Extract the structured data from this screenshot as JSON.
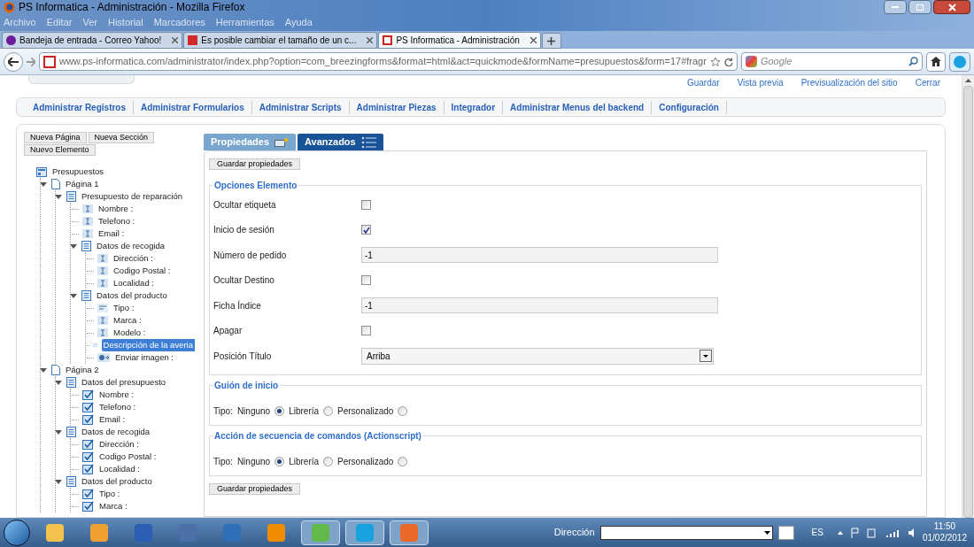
{
  "window": {
    "title": "PS Informatica - Administración - Mozilla Firefox"
  },
  "menu": [
    "Archivo",
    "Editar",
    "Ver",
    "Historial",
    "Marcadores",
    "Herramientas",
    "Ayuda"
  ],
  "browser_tabs": [
    {
      "label": "Bandeja de entrada - Correo Yahoo!",
      "selected": false
    },
    {
      "label": "Es posible cambiar el tamaño de un c...",
      "selected": false
    },
    {
      "label": "PS Informatica - Administración",
      "selected": true
    }
  ],
  "address": "www.ps-informatica.com/administrator/index.php?option=com_breezingforms&format=html&act=quickmode&formName=presupuestos&form=17#fragr",
  "search": {
    "placeholder": "Google"
  },
  "top_links": [
    "Guardar",
    "Vista previa",
    "Previsualización del sitio",
    "Cerrar"
  ],
  "nav": [
    "Administrar Registros",
    "Administrar Formularios",
    "Administrar Scripts",
    "Administrar Piezas",
    "Integrador",
    "Administrar Menus del backend",
    "Configuración"
  ],
  "tree_buttons": [
    "Nueva Página",
    "Nueva Sección",
    "Nuevo Elemento"
  ],
  "tree": {
    "label": "Presupuestos",
    "kind": "form",
    "children": [
      {
        "label": "Página 1",
        "kind": "page",
        "expanded": true,
        "children": [
          {
            "label": "Presupuesto de reparación",
            "kind": "section",
            "expanded": true,
            "children": [
              {
                "label": "Nombre :",
                "kind": "text",
                "selected": false
              },
              {
                "label": "Telefono :",
                "kind": "text",
                "selected": false
              },
              {
                "label": "Email :",
                "kind": "text",
                "selected": false
              },
              {
                "label": "Datos de recogida",
                "kind": "section",
                "expanded": true,
                "children": [
                  {
                    "label": "Dirección :",
                    "kind": "text",
                    "selected": false
                  },
                  {
                    "label": "Codigo Postal :",
                    "kind": "text",
                    "selected": false
                  },
                  {
                    "label": "Localidad :",
                    "kind": "text",
                    "selected": false
                  }
                ]
              },
              {
                "label": "Datos del producto",
                "kind": "section",
                "expanded": true,
                "children": [
                  {
                    "label": "Tipo :",
                    "kind": "select",
                    "selected": false
                  },
                  {
                    "label": "Marca :",
                    "kind": "text",
                    "selected": false
                  },
                  {
                    "label": "Modelo :",
                    "kind": "text",
                    "selected": false
                  },
                  {
                    "label": "Descripción de la averia",
                    "kind": "textarea",
                    "selected": true
                  },
                  {
                    "label": "Enviar imagen :",
                    "kind": "file",
                    "selected": false
                  }
                ]
              }
            ]
          }
        ]
      },
      {
        "label": "Página 2",
        "kind": "page",
        "expanded": true,
        "children": [
          {
            "label": "Datos del presupuesto",
            "kind": "section",
            "expanded": true,
            "children": [
              {
                "label": "Nombre :",
                "kind": "summary",
                "selected": false
              },
              {
                "label": "Telefono :",
                "kind": "summary",
                "selected": false
              },
              {
                "label": "Email :",
                "kind": "summary",
                "selected": false
              }
            ]
          },
          {
            "label": "Datos de recogida",
            "kind": "section",
            "expanded": true,
            "children": [
              {
                "label": "Dirección :",
                "kind": "summary",
                "selected": false
              },
              {
                "label": "Codigo Postal :",
                "kind": "summary",
                "selected": false
              },
              {
                "label": "Localidad :",
                "kind": "summary",
                "selected": false
              }
            ]
          },
          {
            "label": "Datos del producto",
            "kind": "section",
            "expanded": true,
            "children": [
              {
                "label": "Tipo :",
                "kind": "summary",
                "selected": false
              },
              {
                "label": "Marca :",
                "kind": "summary",
                "selected": false
              }
            ]
          }
        ]
      }
    ]
  },
  "panel_tabs": [
    {
      "label": "Propiedades",
      "selected": false
    },
    {
      "label": "Avanzados",
      "selected": true
    }
  ],
  "save_button": "Guardar propiedades",
  "options": {
    "legend": "Opciones Elemento",
    "rows": [
      {
        "label": "Ocultar etiqueta",
        "kind": "checkbox",
        "checked": false
      },
      {
        "label": "Inicio de sesión",
        "kind": "checkbox",
        "checked": true
      },
      {
        "label": "Número de pedido",
        "kind": "input",
        "value": "-1"
      },
      {
        "label": "Ocultar Destino",
        "kind": "checkbox",
        "checked": false
      },
      {
        "label": "Ficha Índice",
        "kind": "input",
        "value": "-1"
      },
      {
        "label": "Apagar",
        "kind": "checkbox",
        "checked": false
      },
      {
        "label": "Posición Título",
        "kind": "select",
        "value": "Arriba"
      }
    ]
  },
  "scripts": [
    {
      "legend": "Guión de inicio",
      "prefix": "Tipo:",
      "choices": [
        {
          "label": "Ninguno",
          "selected": true
        },
        {
          "label": "Librería",
          "selected": false
        },
        {
          "label": "Personalizado",
          "selected": false
        }
      ]
    },
    {
      "legend": "Acción de secuencia de comandos (Actionscript)",
      "prefix": "Tipo:",
      "choices": [
        {
          "label": "Ninguno",
          "selected": true
        },
        {
          "label": "Librería",
          "selected": false
        },
        {
          "label": "Personalizado",
          "selected": false
        }
      ]
    }
  ],
  "save_button_bottom": "Guardar propiedades",
  "taskbar": {
    "address_label": "Dirección",
    "language": "ES",
    "time": "11:50",
    "date": "01/02/2012"
  }
}
